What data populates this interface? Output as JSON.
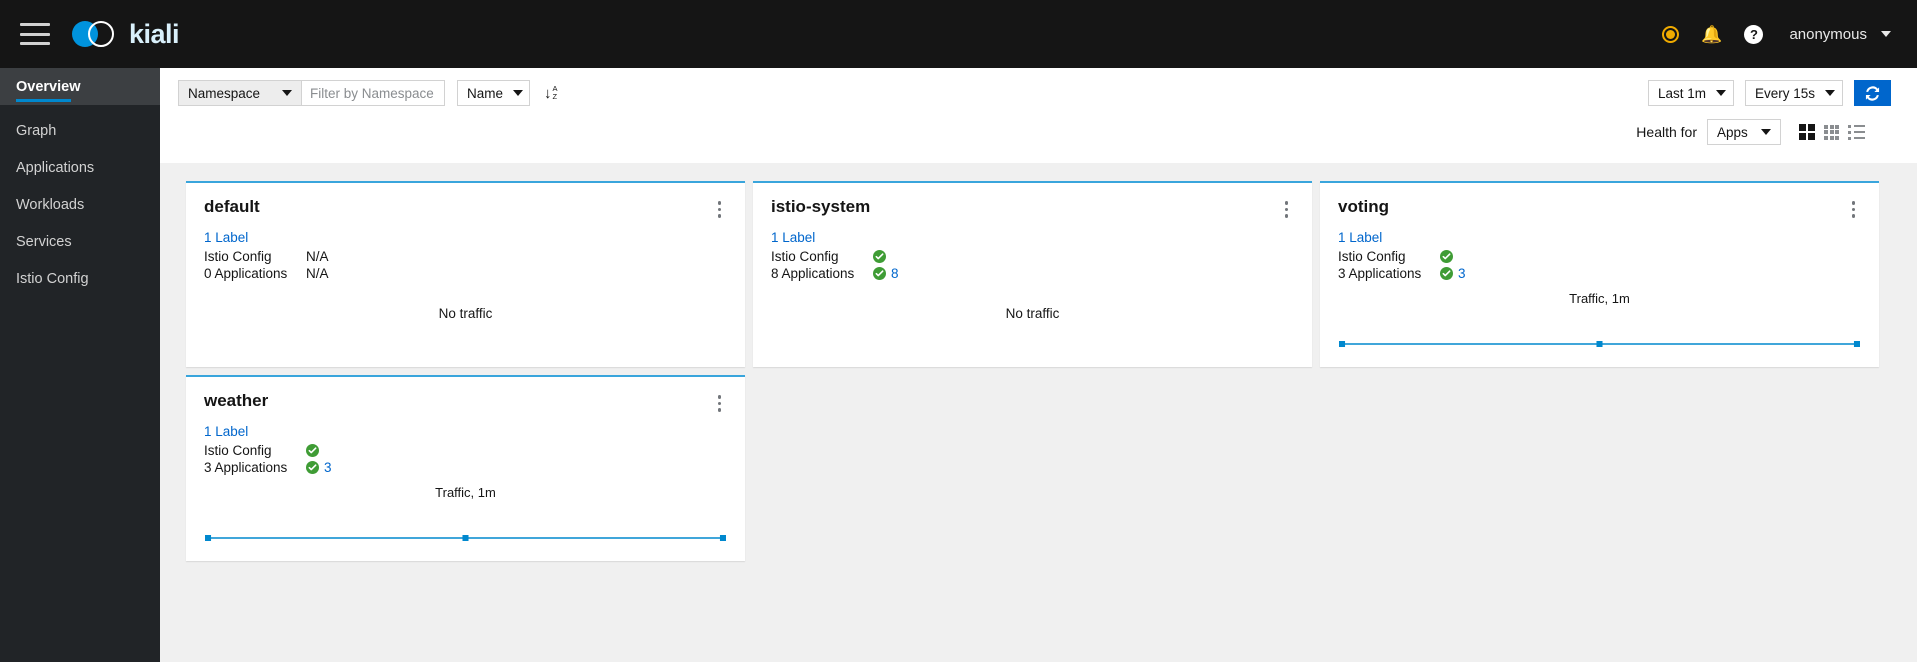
{
  "masthead": {
    "brand": "kiali",
    "hamburger_icon": "hamburger-menu-icon",
    "status_icon": "status-circle-icon",
    "bell_icon": "bell-icon",
    "help_icon": "help-question-icon",
    "user": "anonymous"
  },
  "sidebar": {
    "items": [
      {
        "label": "Overview",
        "active": true
      },
      {
        "label": "Graph",
        "active": false
      },
      {
        "label": "Applications",
        "active": false
      },
      {
        "label": "Workloads",
        "active": false
      },
      {
        "label": "Services",
        "active": false
      },
      {
        "label": "Istio Config",
        "active": false
      }
    ]
  },
  "toolbar": {
    "namespace_select": "Namespace",
    "namespace_filter_placeholder": "Filter by Namespace",
    "namespace_filter_value": "",
    "sort_select": "Name",
    "sort_direction_icon": "sort-alpha-asc-icon",
    "time_range": "Last 1m",
    "refresh_interval": "Every 15s",
    "refresh_icon": "refresh-icon",
    "health_for_label": "Health for",
    "health_for_value": "Apps",
    "view_expand_icon": "view-expand-icon",
    "view_compact_icon": "view-compact-icon",
    "view_list_icon": "view-list-icon"
  },
  "cards": [
    {
      "name": "default",
      "labels": "1 Label",
      "istio_config_label": "Istio Config",
      "istio_config_status": "N/A",
      "istio_config_healthy": false,
      "applications_label": "0 Applications",
      "applications_status": "N/A",
      "applications_healthy": false,
      "applications_count": "",
      "traffic_label": "",
      "no_traffic_text": "No traffic",
      "has_traffic": false
    },
    {
      "name": "istio-system",
      "labels": "1 Label",
      "istio_config_label": "Istio Config",
      "istio_config_status": "",
      "istio_config_healthy": true,
      "applications_label": "8 Applications",
      "applications_status": "",
      "applications_healthy": true,
      "applications_count": "8",
      "traffic_label": "",
      "no_traffic_text": "No traffic",
      "has_traffic": false
    },
    {
      "name": "voting",
      "labels": "1 Label",
      "istio_config_label": "Istio Config",
      "istio_config_status": "",
      "istio_config_healthy": true,
      "applications_label": "3 Applications",
      "applications_status": "",
      "applications_healthy": true,
      "applications_count": "3",
      "traffic_label": "Traffic, 1m",
      "no_traffic_text": "",
      "has_traffic": true
    },
    {
      "name": "weather",
      "labels": "1 Label",
      "istio_config_label": "Istio Config",
      "istio_config_status": "",
      "istio_config_healthy": true,
      "applications_label": "3 Applications",
      "applications_status": "",
      "applications_healthy": true,
      "applications_count": "3",
      "traffic_label": "Traffic, 1m",
      "no_traffic_text": "",
      "has_traffic": true
    }
  ],
  "chart_data": [
    {
      "type": "line",
      "title": "Traffic, 1m",
      "namespace": "voting",
      "x": [
        0,
        0.5,
        1
      ],
      "series": [
        {
          "name": "traffic",
          "values": [
            0,
            0,
            0
          ]
        }
      ],
      "ylim": [
        0,
        1
      ],
      "grid": false,
      "legend": "none",
      "color": "#0088ce"
    },
    {
      "type": "line",
      "title": "Traffic, 1m",
      "namespace": "weather",
      "x": [
        0,
        0.5,
        1
      ],
      "series": [
        {
          "name": "traffic",
          "values": [
            0,
            0,
            0
          ]
        }
      ],
      "ylim": [
        0,
        1
      ],
      "grid": false,
      "legend": "none",
      "color": "#0088ce"
    }
  ],
  "colors": {
    "accent": "#0066cc",
    "card_border": "#39a5dc",
    "healthy": "#3f9c35",
    "status": "#f0ab00",
    "masthead": "#151515",
    "sidebar": "#212427"
  }
}
